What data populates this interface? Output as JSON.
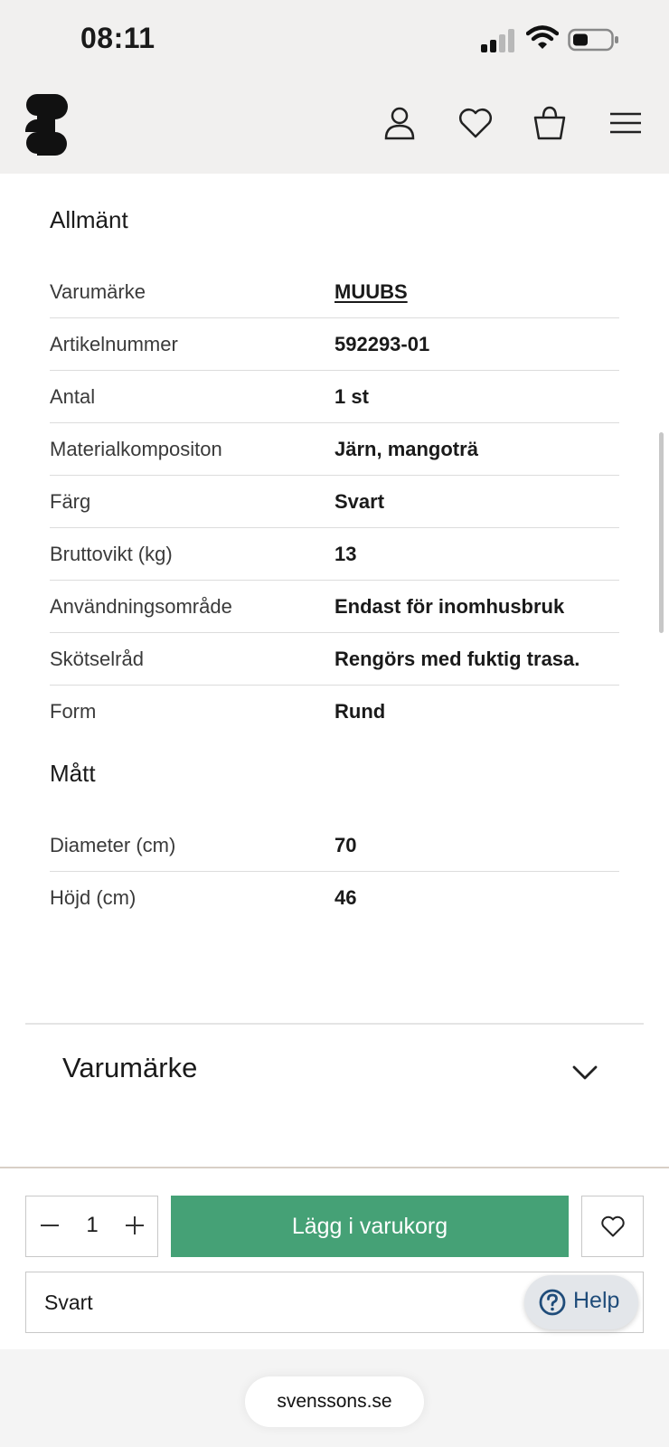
{
  "status_bar": {
    "time": "08:11"
  },
  "header": {
    "icons": [
      "logo-icon",
      "user-icon",
      "heart-icon",
      "shopping-bag-icon",
      "menu-icon"
    ]
  },
  "general": {
    "title": "Allmänt",
    "rows": [
      {
        "label": "Varumärke",
        "value": "MUUBS"
      },
      {
        "label": "Artikelnummer",
        "value": "592293-01"
      },
      {
        "label": "Antal",
        "value": "1 st"
      },
      {
        "label": "Materialkompositon",
        "value": "Järn, mangoträ"
      },
      {
        "label": "Färg",
        "value": "Svart"
      },
      {
        "label": "Bruttovikt (kg)",
        "value": "13"
      },
      {
        "label": "Användningsområde",
        "value": "Endast för inomhusbruk"
      },
      {
        "label": "Skötselråd",
        "value": "Rengörs med fuktig trasa."
      },
      {
        "label": "Form",
        "value": "Rund"
      }
    ]
  },
  "dimensions": {
    "title": "Mått",
    "rows": [
      {
        "label": "Diameter (cm)",
        "value": "70"
      },
      {
        "label": "Höjd (cm)",
        "value": "46"
      }
    ]
  },
  "accordion": {
    "title": "Varumärke"
  },
  "cart_bar": {
    "quantity": "1",
    "add_to_cart_label": "Lägg i varukorg",
    "variant": "Svart",
    "help_label": "Help"
  },
  "browser": {
    "url": "svenssons.se"
  },
  "colors": {
    "header_bg": "#f1f0ef",
    "primary_green": "#45a176",
    "help_text": "#1f4c7a"
  }
}
